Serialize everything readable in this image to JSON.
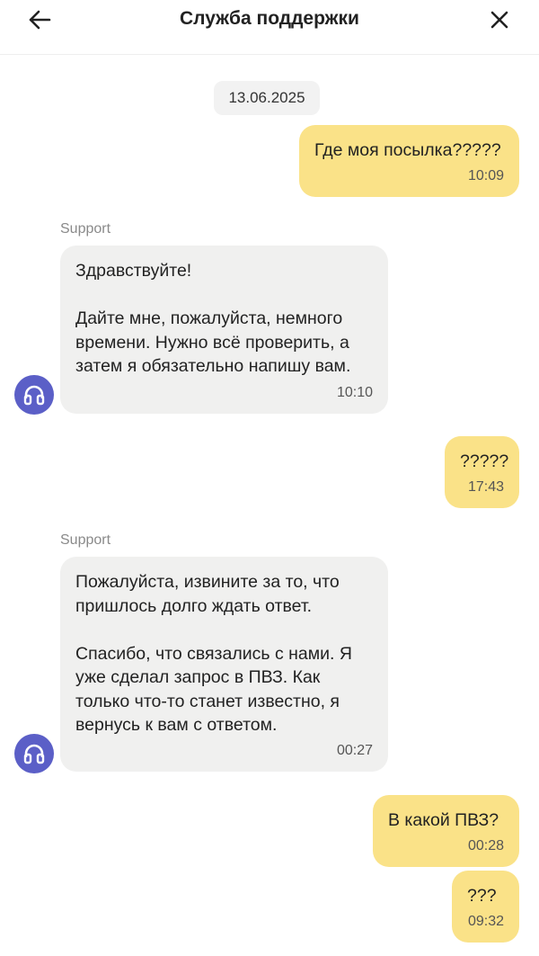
{
  "header": {
    "title": "Служба поддержки",
    "back_icon": "arrow-left-icon",
    "close_icon": "close-icon"
  },
  "chat": {
    "date": "13.06.2025",
    "support_avatar_icon": "headphones-icon",
    "messages": [
      {
        "from": "user",
        "text": "Где моя посылка?????",
        "time": "10:09"
      },
      {
        "from": "support",
        "sender": "Support",
        "text": "Здравствуйте!\n\nДайте мне, пожалуйста, немного\nвремени. Нужно всё проверить, а\nзатем я обязательно напишу вам.",
        "time": "10:10"
      },
      {
        "from": "user",
        "text": "?????",
        "time": "17:43"
      },
      {
        "from": "support",
        "sender": "Support",
        "text": "Пожалуйста, извините за то, что\nпришлось долго ждать ответ.\n\nСпасибо, что связались с нами. Я\nуже сделал запрос в ПВЗ. Как\nтолько что-то станет известно, я\nвернусь к вам с ответом.",
        "time": "00:27"
      },
      {
        "from": "user",
        "text": "В какой ПВЗ?",
        "time": "00:28"
      },
      {
        "from": "user",
        "text": "???",
        "time": "09:32"
      }
    ]
  },
  "colors": {
    "user_bubble": "#fae288",
    "support_bubble": "#f0f0ef",
    "avatar": "#5b5fc7"
  }
}
